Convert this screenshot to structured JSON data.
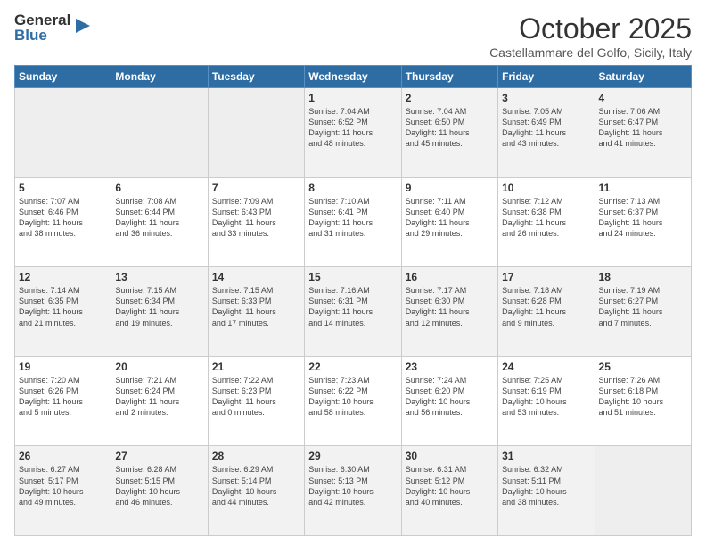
{
  "header": {
    "logo_general": "General",
    "logo_blue": "Blue",
    "month_title": "October 2025",
    "subtitle": "Castellammare del Golfo, Sicily, Italy"
  },
  "weekdays": [
    "Sunday",
    "Monday",
    "Tuesday",
    "Wednesday",
    "Thursday",
    "Friday",
    "Saturday"
  ],
  "weeks": [
    [
      {
        "day": "",
        "info": ""
      },
      {
        "day": "",
        "info": ""
      },
      {
        "day": "",
        "info": ""
      },
      {
        "day": "1",
        "info": "Sunrise: 7:04 AM\nSunset: 6:52 PM\nDaylight: 11 hours\nand 48 minutes."
      },
      {
        "day": "2",
        "info": "Sunrise: 7:04 AM\nSunset: 6:50 PM\nDaylight: 11 hours\nand 45 minutes."
      },
      {
        "day": "3",
        "info": "Sunrise: 7:05 AM\nSunset: 6:49 PM\nDaylight: 11 hours\nand 43 minutes."
      },
      {
        "day": "4",
        "info": "Sunrise: 7:06 AM\nSunset: 6:47 PM\nDaylight: 11 hours\nand 41 minutes."
      }
    ],
    [
      {
        "day": "5",
        "info": "Sunrise: 7:07 AM\nSunset: 6:46 PM\nDaylight: 11 hours\nand 38 minutes."
      },
      {
        "day": "6",
        "info": "Sunrise: 7:08 AM\nSunset: 6:44 PM\nDaylight: 11 hours\nand 36 minutes."
      },
      {
        "day": "7",
        "info": "Sunrise: 7:09 AM\nSunset: 6:43 PM\nDaylight: 11 hours\nand 33 minutes."
      },
      {
        "day": "8",
        "info": "Sunrise: 7:10 AM\nSunset: 6:41 PM\nDaylight: 11 hours\nand 31 minutes."
      },
      {
        "day": "9",
        "info": "Sunrise: 7:11 AM\nSunset: 6:40 PM\nDaylight: 11 hours\nand 29 minutes."
      },
      {
        "day": "10",
        "info": "Sunrise: 7:12 AM\nSunset: 6:38 PM\nDaylight: 11 hours\nand 26 minutes."
      },
      {
        "day": "11",
        "info": "Sunrise: 7:13 AM\nSunset: 6:37 PM\nDaylight: 11 hours\nand 24 minutes."
      }
    ],
    [
      {
        "day": "12",
        "info": "Sunrise: 7:14 AM\nSunset: 6:35 PM\nDaylight: 11 hours\nand 21 minutes."
      },
      {
        "day": "13",
        "info": "Sunrise: 7:15 AM\nSunset: 6:34 PM\nDaylight: 11 hours\nand 19 minutes."
      },
      {
        "day": "14",
        "info": "Sunrise: 7:15 AM\nSunset: 6:33 PM\nDaylight: 11 hours\nand 17 minutes."
      },
      {
        "day": "15",
        "info": "Sunrise: 7:16 AM\nSunset: 6:31 PM\nDaylight: 11 hours\nand 14 minutes."
      },
      {
        "day": "16",
        "info": "Sunrise: 7:17 AM\nSunset: 6:30 PM\nDaylight: 11 hours\nand 12 minutes."
      },
      {
        "day": "17",
        "info": "Sunrise: 7:18 AM\nSunset: 6:28 PM\nDaylight: 11 hours\nand 9 minutes."
      },
      {
        "day": "18",
        "info": "Sunrise: 7:19 AM\nSunset: 6:27 PM\nDaylight: 11 hours\nand 7 minutes."
      }
    ],
    [
      {
        "day": "19",
        "info": "Sunrise: 7:20 AM\nSunset: 6:26 PM\nDaylight: 11 hours\nand 5 minutes."
      },
      {
        "day": "20",
        "info": "Sunrise: 7:21 AM\nSunset: 6:24 PM\nDaylight: 11 hours\nand 2 minutes."
      },
      {
        "day": "21",
        "info": "Sunrise: 7:22 AM\nSunset: 6:23 PM\nDaylight: 11 hours\nand 0 minutes."
      },
      {
        "day": "22",
        "info": "Sunrise: 7:23 AM\nSunset: 6:22 PM\nDaylight: 10 hours\nand 58 minutes."
      },
      {
        "day": "23",
        "info": "Sunrise: 7:24 AM\nSunset: 6:20 PM\nDaylight: 10 hours\nand 56 minutes."
      },
      {
        "day": "24",
        "info": "Sunrise: 7:25 AM\nSunset: 6:19 PM\nDaylight: 10 hours\nand 53 minutes."
      },
      {
        "day": "25",
        "info": "Sunrise: 7:26 AM\nSunset: 6:18 PM\nDaylight: 10 hours\nand 51 minutes."
      }
    ],
    [
      {
        "day": "26",
        "info": "Sunrise: 6:27 AM\nSunset: 5:17 PM\nDaylight: 10 hours\nand 49 minutes."
      },
      {
        "day": "27",
        "info": "Sunrise: 6:28 AM\nSunset: 5:15 PM\nDaylight: 10 hours\nand 46 minutes."
      },
      {
        "day": "28",
        "info": "Sunrise: 6:29 AM\nSunset: 5:14 PM\nDaylight: 10 hours\nand 44 minutes."
      },
      {
        "day": "29",
        "info": "Sunrise: 6:30 AM\nSunset: 5:13 PM\nDaylight: 10 hours\nand 42 minutes."
      },
      {
        "day": "30",
        "info": "Sunrise: 6:31 AM\nSunset: 5:12 PM\nDaylight: 10 hours\nand 40 minutes."
      },
      {
        "day": "31",
        "info": "Sunrise: 6:32 AM\nSunset: 5:11 PM\nDaylight: 10 hours\nand 38 minutes."
      },
      {
        "day": "",
        "info": ""
      }
    ]
  ]
}
